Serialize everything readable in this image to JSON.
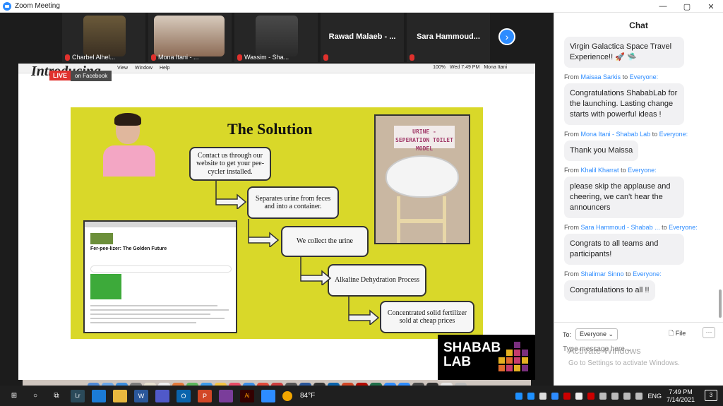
{
  "window": {
    "title": "Zoom Meeting",
    "controls": [
      "—",
      "▢",
      "✕"
    ]
  },
  "gallery": {
    "participants": [
      {
        "name": "Charbel Alhel..."
      },
      {
        "name": "Mona Itani - ..."
      },
      {
        "name": "Wassim - Sha..."
      },
      {
        "name": "Rawad Malaeb - ..."
      },
      {
        "name": "Sara Hammoud..."
      }
    ],
    "next_label": "›"
  },
  "share": {
    "heading_partial": "Introducing",
    "live_label": "LIVE",
    "live_platform": "on Facebook",
    "mac_menus": [
      "View",
      "Window",
      "Help"
    ],
    "mac_status": {
      "battery": "100%",
      "clock": "Wed 7:49 PM",
      "user": "Mona Itani"
    },
    "slide": {
      "title": "The Solution",
      "steps": [
        "Contact us through our website to get your pee-cycler installed.",
        "Separates urine from feces and into a container.",
        "We collect the urine",
        "Alkaline Dehydration Process",
        "Concentrated solid fertilizer sold at cheap prices"
      ],
      "photo_sign": "URINE - SEPERATION TOILET MODEL",
      "website_title": "Fer-pee-lizer: The Golden Future"
    },
    "watermark": {
      "line1": "Activate Windows",
      "line2": "Go to Settings to activate Windows."
    },
    "logo": {
      "line1": "SHABAB",
      "line2": "LAB"
    }
  },
  "chat": {
    "header": "Chat",
    "messages": [
      {
        "from": "",
        "to": "",
        "text": "Virgin Galactica Space Travel Experience!! 🚀 🛸"
      },
      {
        "from": "Maisaa Sarkis",
        "to": "Everyone:",
        "text": "Congratulations ShababLab for the launching.  Lasting change starts with powerful ideas !"
      },
      {
        "from": "Mona Itani - Shabab Lab",
        "to": "Everyone:",
        "text": "Thank you Maissa"
      },
      {
        "from": "Khalil Kharrat",
        "to": "Everyone:",
        "text": "please skip the applause and cheering, we can't hear the announcers"
      },
      {
        "from": "Sara Hammoud - Shabab ...",
        "to": "Everyone:",
        "text": "Congrats to all teams and participants!"
      },
      {
        "from": "Shalimar Sinno",
        "to": "Everyone:",
        "text": "Congratulations to all !!"
      }
    ],
    "from_word": "From",
    "to_word": "to",
    "to_label": "To:",
    "to_value": "Everyone",
    "file_label": "File",
    "more_label": "···",
    "input_placeholder": "Type message here..."
  },
  "taskbar": {
    "weather": "84°F",
    "language": "ENG",
    "time": "7:49 PM",
    "date": "7/14/2021",
    "notifications": "3"
  },
  "colors": {
    "zoom_blue": "#2d8cff",
    "slide_yellow": "#d9d829",
    "live_red": "#e0312d"
  }
}
